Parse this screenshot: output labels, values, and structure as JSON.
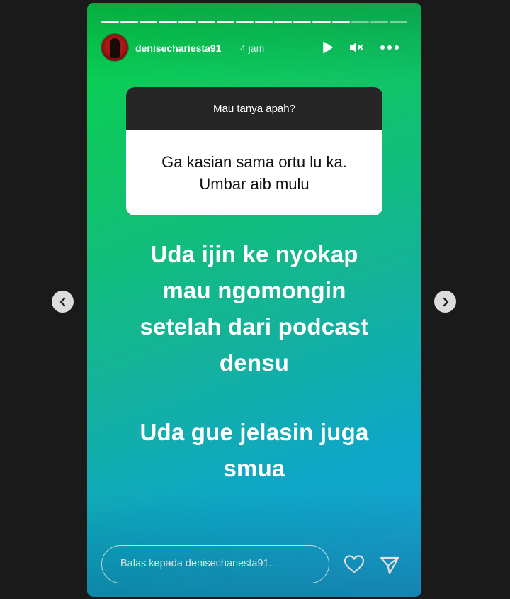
{
  "story": {
    "username": "denisechariesta91",
    "time": "4 jam",
    "progress_segments": 16,
    "progress_viewed": 13
  },
  "header_icons": [
    "play-icon",
    "mute-icon",
    "more-icon"
  ],
  "question": {
    "prompt": "Mau tanya apah?",
    "answer_lines": [
      "Ga kasian sama ortu lu ka.",
      "Umbar aib mulu"
    ]
  },
  "caption": {
    "block1": [
      "Uda ijin ke nyokap",
      "mau ngomongin",
      "setelah dari podcast",
      "densu"
    ],
    "block2": [
      "Uda gue jelasin juga",
      "smua"
    ]
  },
  "reply": {
    "placeholder": "Balas kepada denisechariesta91..."
  },
  "colors": {
    "background": "#1a1a1a",
    "gradient_top": "#06d44a",
    "gradient_bottom": "#1aa0d8",
    "question_header": "#262626"
  }
}
